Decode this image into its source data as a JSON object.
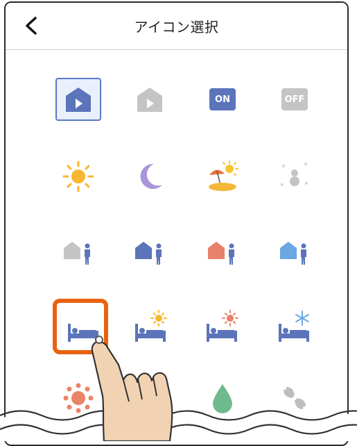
{
  "header": {
    "title": "アイコン選択"
  },
  "rows": [
    {
      "icons": [
        {
          "name": "home-play-icon",
          "selected": true,
          "color": "#5b74ba"
        },
        {
          "name": "home-play-gray-icon",
          "selected": false,
          "color": "#c4c4c4"
        },
        {
          "name": "on-icon",
          "label": "ON",
          "color": "#5b74ba"
        },
        {
          "name": "off-icon",
          "label": "OFF",
          "color": "#c4c4c4"
        }
      ]
    },
    {
      "icons": [
        {
          "name": "sun-icon"
        },
        {
          "name": "moon-icon"
        },
        {
          "name": "beach-icon"
        },
        {
          "name": "snow-icon"
        }
      ]
    },
    {
      "icons": [
        {
          "name": "home-person-gray-icon"
        },
        {
          "name": "home-person-blue-icon"
        },
        {
          "name": "home-person-red-icon"
        },
        {
          "name": "home-person-lightblue-icon"
        }
      ]
    },
    {
      "icons": [
        {
          "name": "bed-moon-icon"
        },
        {
          "name": "bed-sun-icon"
        },
        {
          "name": "bed-heat-icon"
        },
        {
          "name": "bed-snow-icon"
        }
      ]
    },
    {
      "icons": [
        {
          "name": "heat-icon"
        },
        {
          "name": "cool-icon"
        },
        {
          "name": "drop-icon"
        },
        {
          "name": "fan-icon"
        }
      ]
    }
  ],
  "colors": {
    "accent": "#5b74ba",
    "highlight": "#e8630f",
    "gray": "#c4c4c4"
  }
}
